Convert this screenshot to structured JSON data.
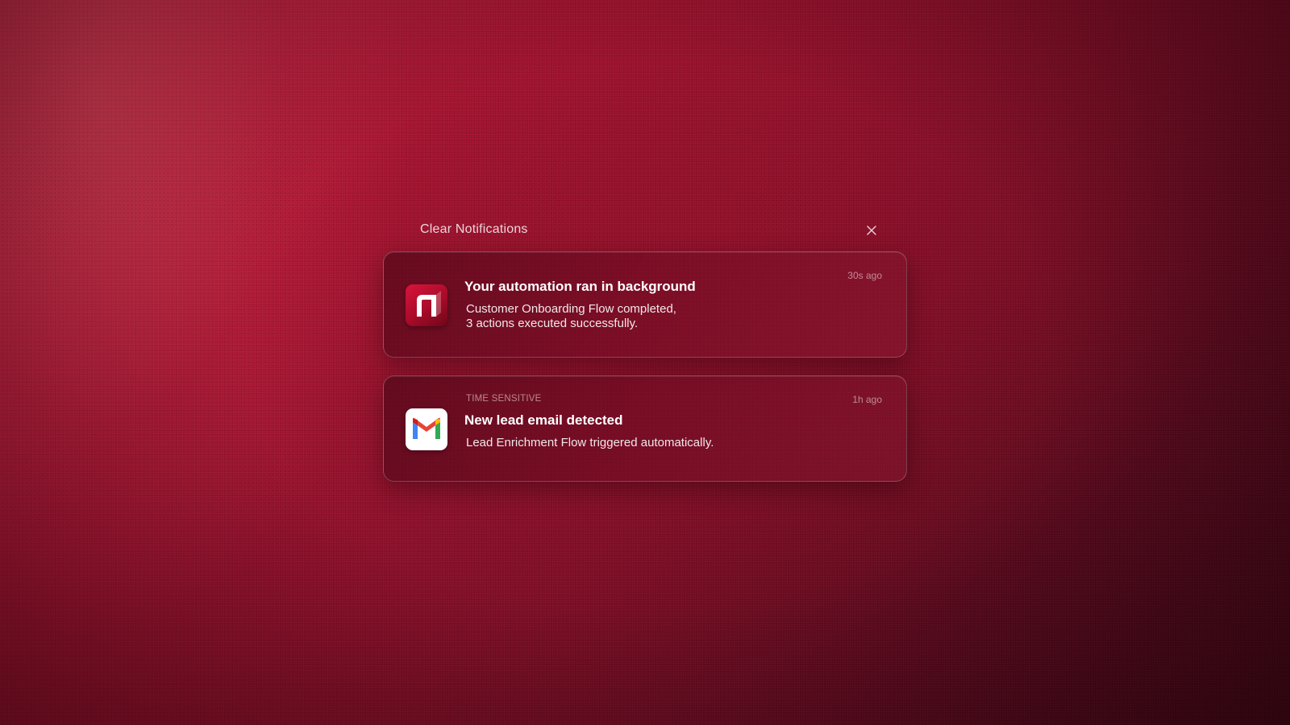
{
  "header": {
    "title": "Clear Notifications",
    "close_icon": "close-icon"
  },
  "notifications": [
    {
      "app_icon": "n8n-automation-icon",
      "time": "30s ago",
      "title": "Your automation ran in background",
      "body_lines": [
        "Customer Onboarding Flow completed,",
        "3 actions executed successfully."
      ]
    },
    {
      "app_icon": "gmail-icon",
      "tag": "TIME SENSITIVE",
      "time": "1h ago",
      "title": "New lead email detected",
      "body_lines": [
        "Lead Enrichment Flow triggered automatically."
      ]
    }
  ],
  "colors": {
    "background_accent": "#a5122f",
    "automation_icon": "#c8102e",
    "gmail_red": "#ea4335",
    "gmail_blue": "#4285f4",
    "gmail_green": "#34a853",
    "gmail_yellow": "#fbbc04"
  }
}
